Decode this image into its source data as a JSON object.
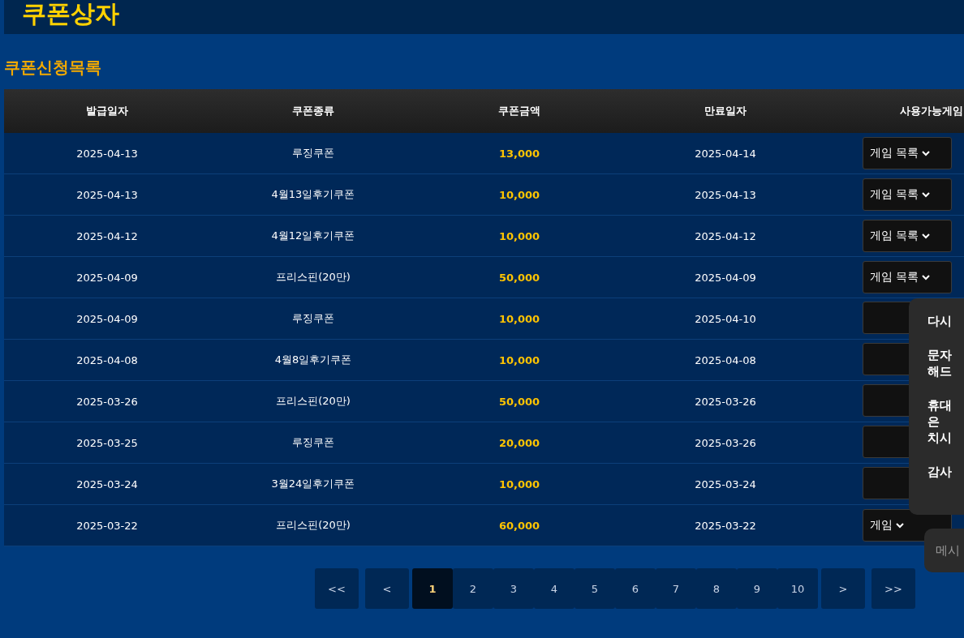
{
  "header": {
    "title": "쿠폰상자"
  },
  "section_title": "쿠폰신청목록",
  "table": {
    "columns": [
      "발급일자",
      "쿠폰종류",
      "쿠폰금액",
      "만료일자",
      "사용가능게임"
    ],
    "rows": [
      {
        "issued": "2025-04-13",
        "type": "루징쿠폰",
        "amount": "13,000",
        "expires": "2025-04-14",
        "games": "게임 목록"
      },
      {
        "issued": "2025-04-13",
        "type": "4월13일후기쿠폰",
        "amount": "10,000",
        "expires": "2025-04-13",
        "games": "게임 목록"
      },
      {
        "issued": "2025-04-12",
        "type": "4월12일후기쿠폰",
        "amount": "10,000",
        "expires": "2025-04-12",
        "games": "게임 목록"
      },
      {
        "issued": "2025-04-09",
        "type": "프리스핀(20만)",
        "amount": "50,000",
        "expires": "2025-04-09",
        "games": "게임 목록"
      },
      {
        "issued": "2025-04-09",
        "type": "루징쿠폰",
        "amount": "10,000",
        "expires": "2025-04-10"
      },
      {
        "issued": "2025-04-08",
        "type": "4월8일후기쿠폰",
        "amount": "10,000",
        "expires": "2025-04-08"
      },
      {
        "issued": "2025-03-26",
        "type": "프리스핀(20만)",
        "amount": "50,000",
        "expires": "2025-03-26"
      },
      {
        "issued": "2025-03-25",
        "type": "루징쿠폰",
        "amount": "20,000",
        "expires": "2025-03-26"
      },
      {
        "issued": "2025-03-24",
        "type": "3월24일후기쿠폰",
        "amount": "10,000",
        "expires": "2025-03-24"
      },
      {
        "issued": "2025-03-22",
        "type": "프리스핀(20만)",
        "amount": "60,000",
        "expires": "2025-03-22",
        "games": "게임"
      }
    ]
  },
  "pagination": [
    {
      "label": "<<",
      "kind": "nav",
      "selected": false
    },
    {
      "label": "<",
      "kind": "nav",
      "selected": false
    },
    {
      "label": "1",
      "kind": "page",
      "selected": true
    },
    {
      "label": "2",
      "kind": "page",
      "selected": false
    },
    {
      "label": "3",
      "kind": "page",
      "selected": false
    },
    {
      "label": "4",
      "kind": "page",
      "selected": false
    },
    {
      "label": "5",
      "kind": "page",
      "selected": false
    },
    {
      "label": "6",
      "kind": "page",
      "selected": false
    },
    {
      "label": "7",
      "kind": "page",
      "selected": false
    },
    {
      "label": "8",
      "kind": "page",
      "selected": false
    },
    {
      "label": "9",
      "kind": "page",
      "selected": false
    },
    {
      "label": "10",
      "kind": "page",
      "selected": false
    },
    {
      "label": ">",
      "kind": "nav",
      "selected": false
    },
    {
      "label": ">>",
      "kind": "nav",
      "selected": false
    }
  ],
  "chat_popup": {
    "messages": [
      "다시",
      "문자\n해드",
      "휴대\n은\n치시",
      "감사"
    ]
  },
  "message_input": {
    "placeholder": "메시"
  }
}
